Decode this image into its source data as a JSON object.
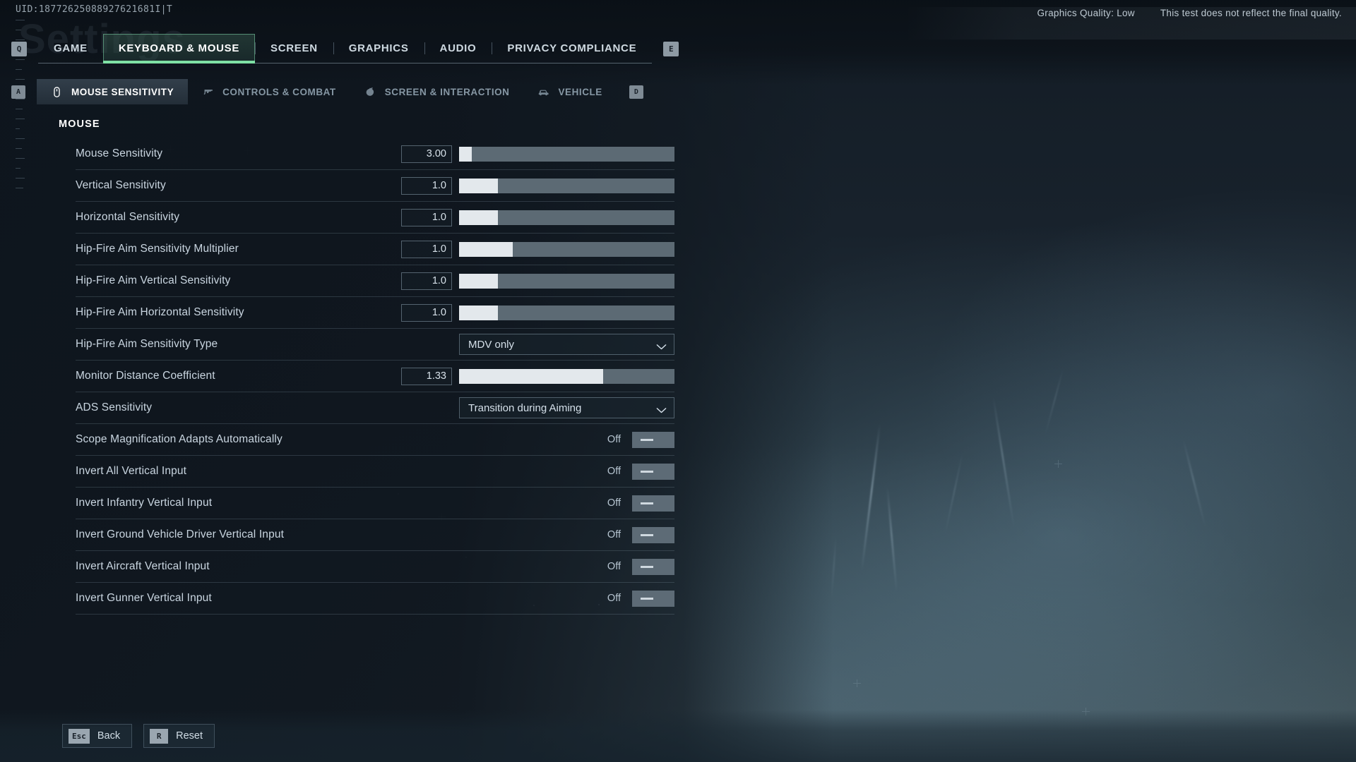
{
  "uid": "UID:18772625088927621681I|T",
  "ghost_title": "Settings",
  "header": {
    "graphics_quality": "Graphics Quality: Low",
    "disclaimer": "This test does not reflect the final quality."
  },
  "tabbar": {
    "left_key": "Q",
    "right_key": "E",
    "tabs": [
      {
        "label": "GAME",
        "active": false
      },
      {
        "label": "KEYBOARD & MOUSE",
        "active": true
      },
      {
        "label": "SCREEN",
        "active": false
      },
      {
        "label": "GRAPHICS",
        "active": false
      },
      {
        "label": "AUDIO",
        "active": false
      },
      {
        "label": "PRIVACY COMPLIANCE",
        "active": false
      }
    ]
  },
  "subbar": {
    "left_key": "A",
    "right_key": "D",
    "tabs": [
      {
        "label": "MOUSE SENSITIVITY",
        "icon": "mouse-icon",
        "active": true
      },
      {
        "label": "CONTROLS & COMBAT",
        "icon": "pistol-icon",
        "active": false
      },
      {
        "label": "SCREEN & INTERACTION",
        "icon": "grenade-icon",
        "active": false
      },
      {
        "label": "VEHICLE",
        "icon": "car-icon",
        "active": false
      }
    ]
  },
  "panel": {
    "section_title": "MOUSE",
    "rows": [
      {
        "label": "Mouse Sensitivity",
        "type": "slider",
        "value": "3.00",
        "fill_pct": 6
      },
      {
        "label": "Vertical Sensitivity",
        "type": "slider",
        "value": "1.0",
        "fill_pct": 18
      },
      {
        "label": "Horizontal Sensitivity",
        "type": "slider",
        "value": "1.0",
        "fill_pct": 18
      },
      {
        "label": "Hip-Fire Aim Sensitivity Multiplier",
        "type": "slider",
        "value": "1.0",
        "fill_pct": 25
      },
      {
        "label": "Hip-Fire Aim Vertical Sensitivity",
        "type": "slider",
        "value": "1.0",
        "fill_pct": 18
      },
      {
        "label": "Hip-Fire Aim Horizontal Sensitivity",
        "type": "slider",
        "value": "1.0",
        "fill_pct": 18
      },
      {
        "label": "Hip-Fire Aim Sensitivity Type",
        "type": "dropdown",
        "value": "MDV only"
      },
      {
        "label": "Monitor Distance Coefficient",
        "type": "slider",
        "value": "1.33",
        "fill_pct": 67
      },
      {
        "label": "ADS Sensitivity",
        "type": "dropdown",
        "value": "Transition during Aiming"
      },
      {
        "label": "Scope Magnification Adapts Automatically",
        "type": "toggle",
        "value": "Off"
      },
      {
        "label": "Invert All Vertical Input",
        "type": "toggle",
        "value": "Off"
      },
      {
        "label": "Invert Infantry Vertical Input",
        "type": "toggle",
        "value": "Off"
      },
      {
        "label": "Invert Ground Vehicle Driver Vertical Input",
        "type": "toggle",
        "value": "Off"
      },
      {
        "label": "Invert Aircraft Vertical Input",
        "type": "toggle",
        "value": "Off"
      },
      {
        "label": "Invert Gunner Vertical Input",
        "type": "toggle",
        "value": "Off"
      }
    ]
  },
  "bottom": {
    "buttons": [
      {
        "key": "Esc",
        "label": "Back"
      },
      {
        "key": "R",
        "label": "Reset"
      }
    ]
  },
  "colors": {
    "accent": "#7ee0a4",
    "slider_fill": "#e3e8ec",
    "slider_track": "#5c6a74"
  }
}
